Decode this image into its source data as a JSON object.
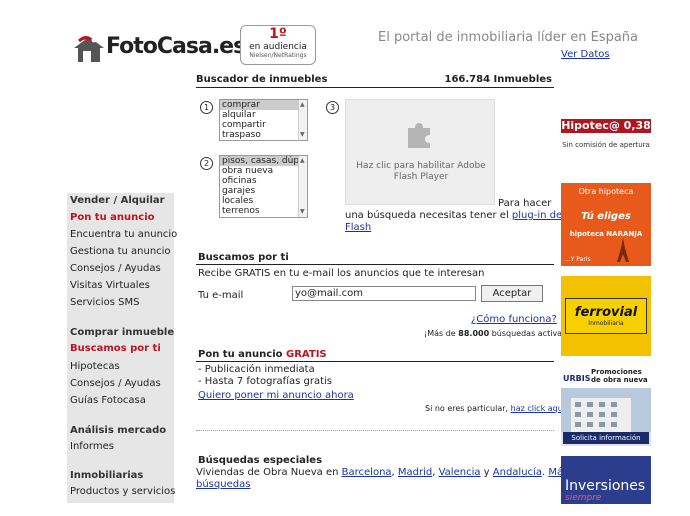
{
  "header": {
    "brand": "FotoCasa.es",
    "rank_number": "1º",
    "rank_line1": "en audiencia",
    "rank_line2": "Nielsen/NetRatings",
    "tagline": "El portal de inmobiliaria líder en España",
    "ver_datos": "Ver Datos"
  },
  "search": {
    "title": "Buscador de inmuebles",
    "count": "166.784 Inmuebles",
    "steps": [
      "1",
      "2",
      "3"
    ],
    "operation_options": [
      "comprar",
      "alquilar",
      "compartir",
      "traspaso"
    ],
    "operation_selected": "comprar",
    "type_options": [
      "pisos, casas, dúple",
      "obra nueva",
      "oficinas",
      "garajes",
      "locales",
      "terrenos"
    ],
    "type_selected": "pisos, casas, dúple",
    "flash_message": "Haz clic para habilitar Adobe Flash Player",
    "flash_note_1": "Para hacer",
    "flash_note_2": "una búsqueda necesitas tener el",
    "flash_link_1": "plug-in de",
    "flash_link_2": "Flash"
  },
  "sidebar": {
    "sections": [
      {
        "heading": "Vender / Alquilar",
        "items": [
          "Pon tu anuncio",
          "Encuentra tu anuncio",
          "Gestiona tu anuncio",
          "Consejos / Ayudas",
          "Visitas Virtuales",
          "Servicios SMS"
        ]
      },
      {
        "heading": "Comprar inmueble",
        "items": [
          "Buscamos por ti",
          "Hipotecas",
          "Consejos / Ayudas",
          "Guías Fotocasa"
        ]
      },
      {
        "heading": "Análisis mercado",
        "items": [
          "Informes"
        ]
      },
      {
        "heading": "Inmobiliarias",
        "items": [
          "Productos y servicios"
        ]
      }
    ]
  },
  "buscamos": {
    "title": "Buscamos por ti",
    "description": "Recibe GRATIS en tu e-mail los anuncios que te interesan",
    "email_label": "Tu e-mail",
    "email_value": "yo@mail.com",
    "accept_label": "Aceptar",
    "how_link": "¿Cómo funciona?",
    "stat_prefix": "¡Más de",
    "stat_number": "88.000",
    "stat_suffix": "búsquedas activas!"
  },
  "anuncio": {
    "title_prefix": "Pon tu anuncio",
    "title_free": "GRATIS",
    "bullet1": "- Publicación inmediata",
    "bullet2": "- Hasta 7 fotografías gratis",
    "link": "Quiero poner mi anuncio ahora",
    "particular_text": "Si no eres particular,",
    "particular_link": "haz click aquí"
  },
  "especiales": {
    "title": "Búsquedas especiales",
    "prefix": "Viviendas de Obra Nueva en",
    "cities": [
      "Barcelona",
      "Madrid",
      "Valencia"
    ],
    "and_word": "y",
    "last_city": "Andalucía",
    "more_1": "Más",
    "more_2": "búsquedas"
  },
  "banners": {
    "hipotec_title": "Hipotec@ 0,38",
    "hipotec_sub": "Sin comisión de apertura",
    "naranja_line1": "Otra hipoteca",
    "naranja_line2": "Tú eliges",
    "naranja_line3": "hipoteca NARANJA",
    "naranja_line4": "...Y París",
    "ferrovial_brand": "ferrovial",
    "ferrovial_sub": "Inmobiliaria",
    "urbis_brand": "URBIS",
    "urbis_promo1": "Promociones",
    "urbis_promo2": "de obra nueva",
    "urbis_cta": "Solicita información",
    "inversiones_title": "Inversiones",
    "inversiones_sub": "siempre"
  },
  "colors": {
    "accent_red": "#c0121e",
    "link_blue": "#1a33a8",
    "sidebar_bg": "#e6e6e6"
  }
}
